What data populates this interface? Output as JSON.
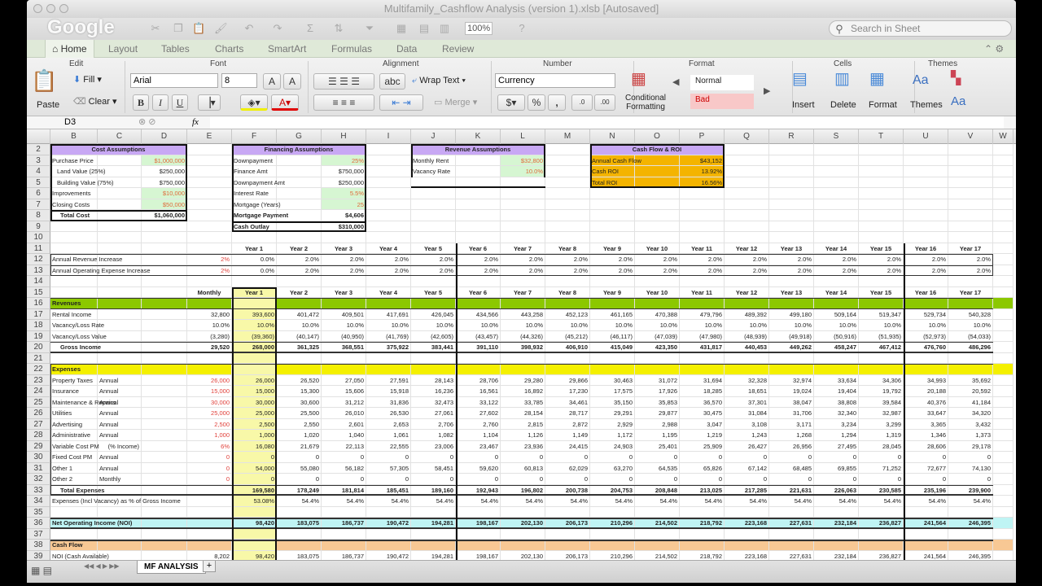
{
  "window": {
    "title": "Multifamily_Cashflow Analysis (version 1).xlsb [Autosaved]",
    "watermark": "Google"
  },
  "toolbar": {
    "zoom": "100%",
    "search_placeholder": "Search in Sheet"
  },
  "ribbon": {
    "tabs": [
      "Home",
      "Layout",
      "Tables",
      "Charts",
      "SmartArt",
      "Formulas",
      "Data",
      "Review"
    ],
    "groups": [
      "Edit",
      "Font",
      "Alignment",
      "Number",
      "Format",
      "Cells",
      "Themes"
    ],
    "fill": "Fill",
    "clear": "Clear",
    "paste": "Paste",
    "font": "Arial",
    "size": "8",
    "bold": "B",
    "italic": "I",
    "underline": "U",
    "wrap_text": "Wrap Text",
    "merge": "Merge",
    "number_format": "Currency",
    "percent": "%",
    "comma": ",",
    "conditional_formatting": "Conditional Formatting",
    "style_normal": "Normal",
    "style_bad": "Bad",
    "insert": "Insert",
    "delete": "Delete",
    "format": "Format",
    "themes": "Themes"
  },
  "formula_bar": {
    "cell_ref": "D3",
    "fx": "fx",
    "value": ""
  },
  "columns": [
    "B",
    "C",
    "D",
    "E",
    "F",
    "G",
    "H",
    "I",
    "J",
    "K",
    "L",
    "M",
    "N",
    "O",
    "P",
    "Q",
    "R",
    "S",
    "T",
    "U",
    "V",
    "W"
  ],
  "rows": {
    "2": {
      "B": "Cost Assumptions",
      "F": "Financing Assumptions",
      "J": "Revenue Assumptions",
      "N": "Cash Flow & ROI"
    },
    "3": {
      "B": "Purchase Price",
      "D": "$1,000,000",
      "F": "Downpayment",
      "H": "25%",
      "J": "Monthly Rent",
      "L": "$32,800",
      "N": "Annual Cash Flow",
      "P": "$43,152"
    },
    "4": {
      "B": "Land Value (25%)",
      "D": "$250,000",
      "F": "Finance Amt",
      "H": "$750,000",
      "J": "Vacancy Rate",
      "L": "10.0%",
      "N": "Cash ROI",
      "P": "13.92%"
    },
    "5": {
      "B": "Building Value (75%)",
      "D": "$750,000",
      "F": "Downpayment Amt",
      "H": "$250,000",
      "N": "Total ROI",
      "P": "16.56%"
    },
    "6": {
      "B": "Improvements",
      "D": "$10,000",
      "F": "Interest Rate",
      "H": "5.5%"
    },
    "7": {
      "B": "Closing Costs",
      "D": "$50,000",
      "F": "Mortgage (Years)",
      "H": "25"
    },
    "8": {
      "B": "Total Cost",
      "D": "$1,060,000",
      "F": "Mortgage Payment",
      "H": "$4,606"
    },
    "9": {
      "F": "Cash Outlay",
      "H": "$310,000"
    },
    "10": {},
    "11": {
      "years": [
        "Year 1",
        "Year 2",
        "Year 3",
        "Year 4",
        "Year 5",
        "Year 6",
        "Year 7",
        "Year 8",
        "Year 9",
        "Year 10",
        "Year 11",
        "Year 12",
        "Year 13",
        "Year 14",
        "Year 15",
        "Year 16",
        "Year 17"
      ]
    },
    "12": {
      "B": "Annual Revenue Increase",
      "E": "2%",
      "years": [
        "0.0%",
        "2.0%",
        "2.0%",
        "2.0%",
        "2.0%",
        "2.0%",
        "2.0%",
        "2.0%",
        "2.0%",
        "2.0%",
        "2.0%",
        "2.0%",
        "2.0%",
        "2.0%",
        "2.0%",
        "2.0%",
        "2.0%"
      ]
    },
    "13": {
      "B": "Annual Operating Expense Increase",
      "E": "2%",
      "years": [
        "0.0%",
        "2.0%",
        "2.0%",
        "2.0%",
        "2.0%",
        "2.0%",
        "2.0%",
        "2.0%",
        "2.0%",
        "2.0%",
        "2.0%",
        "2.0%",
        "2.0%",
        "2.0%",
        "2.0%",
        "2.0%",
        "2.0%"
      ]
    },
    "14": {},
    "15": {
      "E": "Monthly",
      "years": [
        "Year 1",
        "Year 2",
        "Year 3",
        "Year 4",
        "Year 5",
        "Year 6",
        "Year 7",
        "Year 8",
        "Year 9",
        "Year 10",
        "Year 11",
        "Year 12",
        "Year 13",
        "Year 14",
        "Year 15",
        "Year 16",
        "Year 17"
      ]
    },
    "16": {
      "B": "Revenues"
    },
    "17": {
      "B": "Rental Income",
      "E": "32,800",
      "years": [
        "393,600",
        "401,472",
        "409,501",
        "417,691",
        "426,045",
        "434,566",
        "443,258",
        "452,123",
        "461,165",
        "470,388",
        "479,796",
        "489,392",
        "499,180",
        "509,164",
        "519,347",
        "529,734",
        "540,328"
      ]
    },
    "18": {
      "B": "Vacancy/Loss Rate",
      "E": "10.0%",
      "years": [
        "10.0%",
        "10.0%",
        "10.0%",
        "10.0%",
        "10.0%",
        "10.0%",
        "10.0%",
        "10.0%",
        "10.0%",
        "10.0%",
        "10.0%",
        "10.0%",
        "10.0%",
        "10.0%",
        "10.0%",
        "10.0%",
        "10.0%"
      ]
    },
    "19": {
      "B": "Vacancy/Loss Value",
      "E": "(3,280)",
      "years": [
        "(39,360)",
        "(40,147)",
        "(40,950)",
        "(41,769)",
        "(42,605)",
        "(43,457)",
        "(44,326)",
        "(45,212)",
        "(46,117)",
        "(47,039)",
        "(47,980)",
        "(48,939)",
        "(49,918)",
        "(50,916)",
        "(51,935)",
        "(52,973)",
        "(54,033)"
      ]
    },
    "20": {
      "B": "Gross Income",
      "E": "29,520",
      "years": [
        "268,000",
        "361,325",
        "368,551",
        "375,922",
        "383,441",
        "391,110",
        "398,932",
        "406,910",
        "415,049",
        "423,350",
        "431,817",
        "440,453",
        "449,262",
        "458,247",
        "467,412",
        "476,760",
        "486,296"
      ]
    },
    "21": {},
    "22": {
      "B": "Expenses"
    },
    "23": {
      "B": "Property Taxes",
      "C": "Annual",
      "E": "26,000",
      "years": [
        "26,000",
        "26,520",
        "27,050",
        "27,591",
        "28,143",
        "28,706",
        "29,280",
        "29,866",
        "30,463",
        "31,072",
        "31,694",
        "32,328",
        "32,974",
        "33,634",
        "34,306",
        "34,993",
        "35,692"
      ]
    },
    "24": {
      "B": "Insurance",
      "C": "Annual",
      "E": "15,000",
      "years": [
        "15,000",
        "15,300",
        "15,606",
        "15,918",
        "16,236",
        "16,561",
        "16,892",
        "17,230",
        "17,575",
        "17,926",
        "18,285",
        "18,651",
        "19,024",
        "19,404",
        "19,792",
        "20,188",
        "20,592"
      ]
    },
    "25": {
      "B": "Maintenance & Repairs",
      "C": "Annual",
      "E": "30,000",
      "years": [
        "30,000",
        "30,600",
        "31,212",
        "31,836",
        "32,473",
        "33,122",
        "33,785",
        "34,461",
        "35,150",
        "35,853",
        "36,570",
        "37,301",
        "38,047",
        "38,808",
        "39,584",
        "40,376",
        "41,184"
      ]
    },
    "26": {
      "B": "Utilities",
      "C": "Annual",
      "E": "25,000",
      "years": [
        "25,000",
        "25,500",
        "26,010",
        "26,530",
        "27,061",
        "27,602",
        "28,154",
        "28,717",
        "29,291",
        "29,877",
        "30,475",
        "31,084",
        "31,706",
        "32,340",
        "32,987",
        "33,647",
        "34,320"
      ]
    },
    "27": {
      "B": "Advertising",
      "C": "Annual",
      "E": "2,500",
      "years": [
        "2,500",
        "2,550",
        "2,601",
        "2,653",
        "2,706",
        "2,760",
        "2,815",
        "2,872",
        "2,929",
        "2,988",
        "3,047",
        "3,108",
        "3,171",
        "3,234",
        "3,299",
        "3,365",
        "3,432"
      ]
    },
    "28": {
      "B": "Administrative",
      "C": "Annual",
      "E": "1,000",
      "years": [
        "1,000",
        "1,020",
        "1,040",
        "1,061",
        "1,082",
        "1,104",
        "1,126",
        "1,149",
        "1,172",
        "1,195",
        "1,219",
        "1,243",
        "1,268",
        "1,294",
        "1,319",
        "1,346",
        "1,373"
      ]
    },
    "29": {
      "B": "Variable Cost PM",
      "C": "(% Income)",
      "E": "6%",
      "years": [
        "16,080",
        "21,679",
        "22,113",
        "22,555",
        "23,006",
        "23,467",
        "23,936",
        "24,415",
        "24,903",
        "25,401",
        "25,909",
        "26,427",
        "26,956",
        "27,495",
        "28,045",
        "28,606",
        "29,178"
      ]
    },
    "30": {
      "B": "Fixed Cost PM",
      "C": "Annual",
      "E": "0",
      "years": [
        "0",
        "0",
        "0",
        "0",
        "0",
        "0",
        "0",
        "0",
        "0",
        "0",
        "0",
        "0",
        "0",
        "0",
        "0",
        "0",
        "0"
      ]
    },
    "31": {
      "B": "Other 1",
      "C": "Annual",
      "E": "0",
      "years": [
        "54,000",
        "55,080",
        "56,182",
        "57,305",
        "58,451",
        "59,620",
        "60,813",
        "62,029",
        "63,270",
        "64,535",
        "65,826",
        "67,142",
        "68,485",
        "69,855",
        "71,252",
        "72,677",
        "74,130"
      ]
    },
    "32": {
      "B": "Other 2",
      "C": "Monthly",
      "E": "0",
      "years": [
        "0",
        "0",
        "0",
        "0",
        "0",
        "0",
        "0",
        "0",
        "0",
        "0",
        "0",
        "0",
        "0",
        "0",
        "0",
        "0",
        "0"
      ]
    },
    "33": {
      "B": "Total Expenses",
      "years": [
        "169,580",
        "178,249",
        "181,814",
        "185,451",
        "189,160",
        "192,943",
        "196,802",
        "200,738",
        "204,753",
        "208,848",
        "213,025",
        "217,285",
        "221,631",
        "226,063",
        "230,585",
        "235,196",
        "239,900"
      ]
    },
    "34": {
      "B": "Expenses (Incl Vacancy) as % of Gross Income",
      "years": [
        "53.08%",
        "54.4%",
        "54.4%",
        "54.4%",
        "54.4%",
        "54.4%",
        "54.4%",
        "54.4%",
        "54.4%",
        "54.4%",
        "54.4%",
        "54.4%",
        "54.4%",
        "54.4%",
        "54.4%",
        "54.4%",
        "54.4%"
      ]
    },
    "35": {},
    "36": {
      "B": "Net Operating Income (NOI)",
      "years": [
        "98,420",
        "183,075",
        "186,737",
        "190,472",
        "194,281",
        "198,167",
        "202,130",
        "206,173",
        "210,296",
        "214,502",
        "218,792",
        "223,168",
        "227,631",
        "232,184",
        "236,827",
        "241,564",
        "246,395"
      ]
    },
    "37": {},
    "38": {
      "B": "Cash Flow"
    },
    "39": {
      "B": "NOI (Cash Available)",
      "E": "8,202",
      "years": [
        "98,420",
        "183,075",
        "186,737",
        "190,472",
        "194,281",
        "198,167",
        "202,130",
        "206,173",
        "210,296",
        "214,502",
        "218,792",
        "223,168",
        "227,631",
        "232,184",
        "236,827",
        "241,564",
        "246,395"
      ]
    }
  },
  "sheet_tabs": [
    "MF ANALYSIS"
  ],
  "add_sheet": "+",
  "colors": {
    "purple": "#c8a8f4",
    "input_green": "#d6f6d2",
    "gold": "#f4b400",
    "revenues": "#8cc800",
    "expenses": "#f4f000",
    "noi": "#bff4f4",
    "cashflow": "#f8c894",
    "year1": "#f8f8a8"
  }
}
